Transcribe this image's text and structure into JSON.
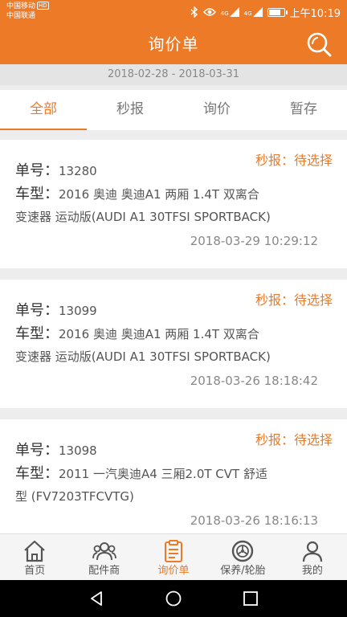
{
  "status_bar": {
    "carrier1": "中国移动",
    "carrier1_badge": "HD",
    "carrier2": "中国联通",
    "signal1": "4G",
    "signal2": "4G",
    "time": "上午10:19",
    "battery_level": 0.8
  },
  "header": {
    "title": "询价单",
    "search_icon": "search-icon"
  },
  "date_range": {
    "start": "2018-02-28",
    "separator": " - ",
    "end": "2018-03-31"
  },
  "tabs": [
    {
      "label": "全部",
      "active": true
    },
    {
      "label": "秒报",
      "active": false
    },
    {
      "label": "询价",
      "active": false
    },
    {
      "label": "暂存",
      "active": false
    }
  ],
  "orders": [
    {
      "status": "秒报：待选择",
      "order_label": "单号：",
      "order_no": "13280",
      "model_label": "车型：",
      "model_line1": "2016 奥迪 奥迪A1 两厢 1.4T 双离合",
      "model_line2": "变速器 运动版(AUDI A1 30TFSI SPORTBACK)",
      "time": "2018-03-29 10:29:12"
    },
    {
      "status": "秒报：待选择",
      "order_label": "单号：",
      "order_no": "13099",
      "model_label": "车型：",
      "model_line1": "2016 奥迪 奥迪A1 两厢 1.4T 双离合",
      "model_line2": "变速器 运动版(AUDI A1 30TFSI SPORTBACK)",
      "time": "2018-03-26 18:18:42"
    },
    {
      "status": "秒报：待选择",
      "order_label": "单号：",
      "order_no": "13098",
      "model_label": "车型：",
      "model_line1": "2011 一汽奥迪A4 三厢2.0T CVT 舒适",
      "model_line2": "型 (FV7203TFCVTG)",
      "time": "2018-03-26 18:16:13"
    }
  ],
  "bottom_nav": [
    {
      "label": "首页",
      "icon": "home-icon",
      "active": false
    },
    {
      "label": "配件商",
      "icon": "suppliers-icon",
      "active": false
    },
    {
      "label": "询价单",
      "icon": "clipboard-icon",
      "active": true
    },
    {
      "label": "保养/轮胎",
      "icon": "tire-icon",
      "active": false
    },
    {
      "label": "我的",
      "icon": "profile-icon",
      "active": false
    }
  ],
  "colors": {
    "brand": "#ed7a27",
    "background": "#ededed"
  }
}
